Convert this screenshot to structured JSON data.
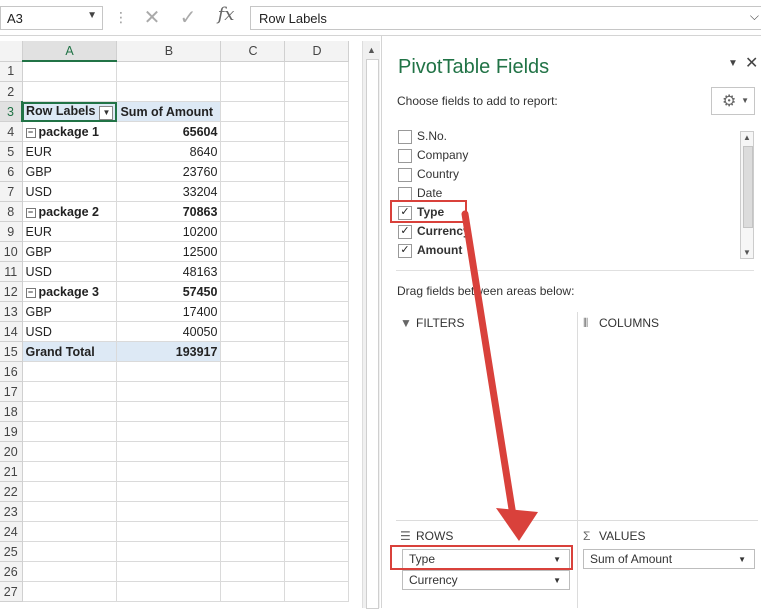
{
  "formula_bar": {
    "name_box": "A3",
    "cancel_glyph": "✕",
    "enter_glyph": "✓",
    "fx_label": "fx",
    "formula": "Row Labels"
  },
  "grid": {
    "columns": [
      "A",
      "B",
      "C",
      "D"
    ],
    "rows": [
      {
        "n": "1",
        "a": "",
        "b": ""
      },
      {
        "n": "2",
        "a": "",
        "b": ""
      },
      {
        "n": "3",
        "a": "Row Labels",
        "b": "Sum of Amount"
      },
      {
        "n": "4",
        "a": "package 1",
        "b": "65604"
      },
      {
        "n": "5",
        "a": "EUR",
        "b": "8640"
      },
      {
        "n": "6",
        "a": "GBP",
        "b": "23760"
      },
      {
        "n": "7",
        "a": "USD",
        "b": "33204"
      },
      {
        "n": "8",
        "a": "package 2",
        "b": "70863"
      },
      {
        "n": "9",
        "a": "EUR",
        "b": "10200"
      },
      {
        "n": "10",
        "a": "GBP",
        "b": "12500"
      },
      {
        "n": "11",
        "a": "USD",
        "b": "48163"
      },
      {
        "n": "12",
        "a": "package 3",
        "b": "57450"
      },
      {
        "n": "13",
        "a": "GBP",
        "b": "17400"
      },
      {
        "n": "14",
        "a": "USD",
        "b": "40050"
      },
      {
        "n": "15",
        "a": "Grand Total",
        "b": "193917"
      },
      {
        "n": "16",
        "a": "",
        "b": ""
      },
      {
        "n": "17",
        "a": "",
        "b": ""
      },
      {
        "n": "18",
        "a": "",
        "b": ""
      },
      {
        "n": "19",
        "a": "",
        "b": ""
      },
      {
        "n": "20",
        "a": "",
        "b": ""
      },
      {
        "n": "21",
        "a": "",
        "b": ""
      },
      {
        "n": "22",
        "a": "",
        "b": ""
      },
      {
        "n": "23",
        "a": "",
        "b": ""
      },
      {
        "n": "24",
        "a": "",
        "b": ""
      },
      {
        "n": "25",
        "a": "",
        "b": ""
      },
      {
        "n": "26",
        "a": "",
        "b": ""
      },
      {
        "n": "27",
        "a": "",
        "b": ""
      }
    ]
  },
  "pivot_pane": {
    "title": "PivotTable Fields",
    "subtitle": "Choose fields to add to report:",
    "fields": [
      {
        "label": "S.No.",
        "checked": false
      },
      {
        "label": "Company",
        "checked": false
      },
      {
        "label": "Country",
        "checked": false
      },
      {
        "label": "Date",
        "checked": false
      },
      {
        "label": "Type",
        "checked": true
      },
      {
        "label": "Currency",
        "checked": true
      },
      {
        "label": "Amount",
        "checked": true
      }
    ],
    "drag_hint": "Drag fields between areas below:",
    "areas": {
      "filters": "FILTERS",
      "columns": "COLUMNS",
      "rows": "ROWS",
      "values": "VALUES"
    },
    "rows_items": [
      "Type",
      "Currency"
    ],
    "values_items": [
      "Sum of Amount"
    ]
  },
  "annotation": {
    "color": "#d9413b"
  },
  "colors": {
    "accent": "#217346",
    "pivot_header": "#dde9f5"
  }
}
